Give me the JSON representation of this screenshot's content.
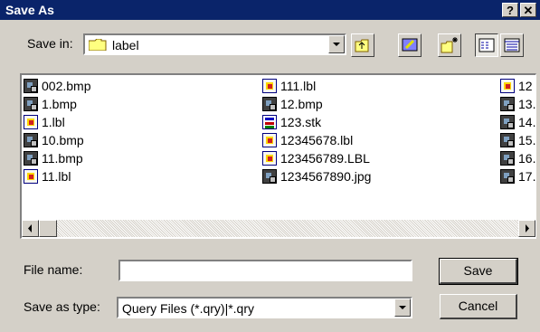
{
  "window": {
    "title": "Save As",
    "help_label": "?",
    "close_label": "✕"
  },
  "toolbar": {
    "save_in_label": "Save in:",
    "save_in_value": "label",
    "icons": [
      "up-one-level-icon",
      "desktop-icon",
      "new-folder-icon",
      "list-view-icon",
      "details-view-icon"
    ]
  },
  "files": [
    {
      "name": "002.bmp",
      "icon": "bitmap-file-icon"
    },
    {
      "name": "1.bmp",
      "icon": "bitmap-file-icon"
    },
    {
      "name": "1.lbl",
      "icon": "label-file-icon"
    },
    {
      "name": "10.bmp",
      "icon": "bitmap-file-icon"
    },
    {
      "name": "11.bmp",
      "icon": "bitmap-file-icon"
    },
    {
      "name": "11.lbl",
      "icon": "label-file-icon"
    },
    {
      "name": "111.lbl",
      "icon": "label-file-icon"
    },
    {
      "name": "12.bmp",
      "icon": "bitmap-file-icon"
    },
    {
      "name": "123.stk",
      "icon": "stack-file-icon"
    },
    {
      "name": "12345678.lbl",
      "icon": "label-file-icon"
    },
    {
      "name": "123456789.LBL",
      "icon": "label-file-icon"
    },
    {
      "name": "1234567890.jpg",
      "icon": "bitmap-file-icon"
    },
    {
      "name": "12",
      "icon": "label-file-icon"
    },
    {
      "name": "13.",
      "icon": "bitmap-file-icon"
    },
    {
      "name": "14.",
      "icon": "bitmap-file-icon"
    },
    {
      "name": "15.",
      "icon": "bitmap-file-icon"
    },
    {
      "name": "16.",
      "icon": "bitmap-file-icon"
    },
    {
      "name": "17.",
      "icon": "bitmap-file-icon"
    }
  ],
  "form": {
    "file_name_label": "File name:",
    "file_name_value": "",
    "save_as_type_label": "Save as type:",
    "save_as_type_value": "Query Files (*.qry)|*.qry"
  },
  "buttons": {
    "save": "Save",
    "cancel": "Cancel"
  }
}
